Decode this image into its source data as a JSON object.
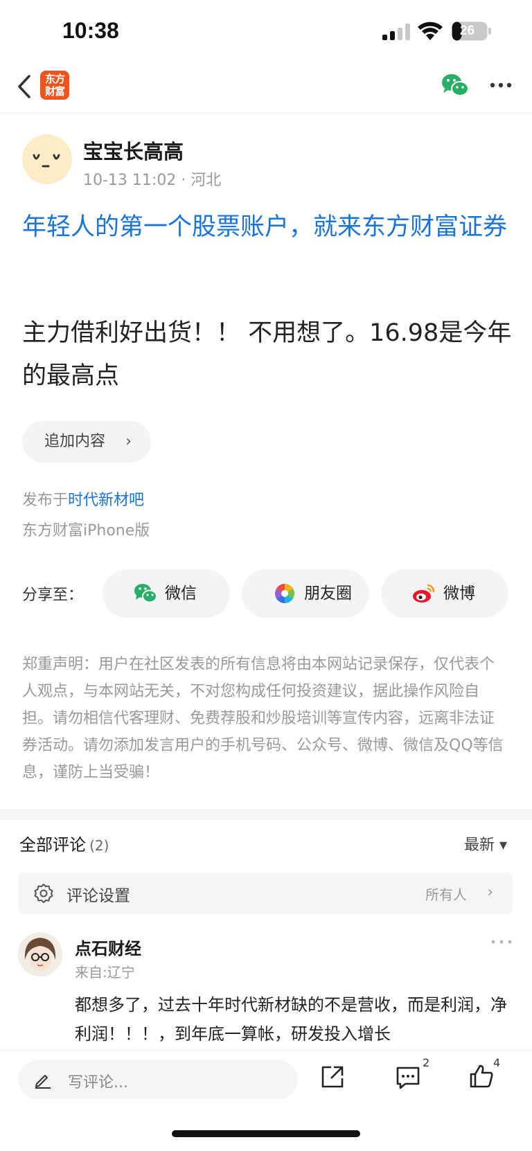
{
  "status_bar": {
    "time": "10:38",
    "battery": "26"
  },
  "nav": {
    "logo_line1": "东方",
    "logo_line2": "财富"
  },
  "author": {
    "name": "宝宝长高高",
    "meta": "10-13 11:02 · 河北"
  },
  "post": {
    "link_text": "年轻人的第一个股票账户，就来东方财富证券",
    "body": "主力借利好出货！！ 不用想了。16.98是今年的最高点"
  },
  "append_button": {
    "label": "追加内容",
    "chevron": "›"
  },
  "publish": {
    "prefix": "发布于",
    "bar_name": "时代新材吧",
    "client": "东方财富iPhone版"
  },
  "share": {
    "label": "分享至：",
    "wechat": "微信",
    "moments": "朋友圈",
    "weibo": "微博"
  },
  "disclaimer": "郑重声明：用户在社区发表的所有信息将由本网站记录保存，仅代表个人观点，与本网站无关，不对您构成任何投资建议，据此操作风险自担。请勿相信代客理财、免费荐股和炒股培训等宣传内容，远离非法证券活动。请勿添加发言用户的手机号码、公众号、微博、微信及QQ等信息，谨防上当受骗！",
  "comments": {
    "title": "全部评论",
    "count": "(2)",
    "sort": "最新 ▾",
    "settings_label": "评论设置",
    "settings_value": "所有人",
    "settings_chevron": "›",
    "items": [
      {
        "name": "点石财经",
        "from": "来自:辽宁",
        "text": "都想多了，过去十年时代新材缺的不是营收，而是利润，净利润！！！，到年底一算帐，研发投入增长"
      }
    ]
  },
  "bottom_bar": {
    "placeholder": "写评论...",
    "comment_count": "2",
    "like_count": "4"
  },
  "colors": {
    "link": "#1a73d9",
    "brand": "#f2541b",
    "wechat": "#2aae67",
    "weibo": "#e6162d"
  },
  "icons": [
    "back-icon",
    "wechat-icon",
    "more-icon",
    "moments-icon",
    "weibo-icon",
    "gear-icon",
    "pen-icon",
    "share-out-icon",
    "comment-icon",
    "like-icon"
  ]
}
